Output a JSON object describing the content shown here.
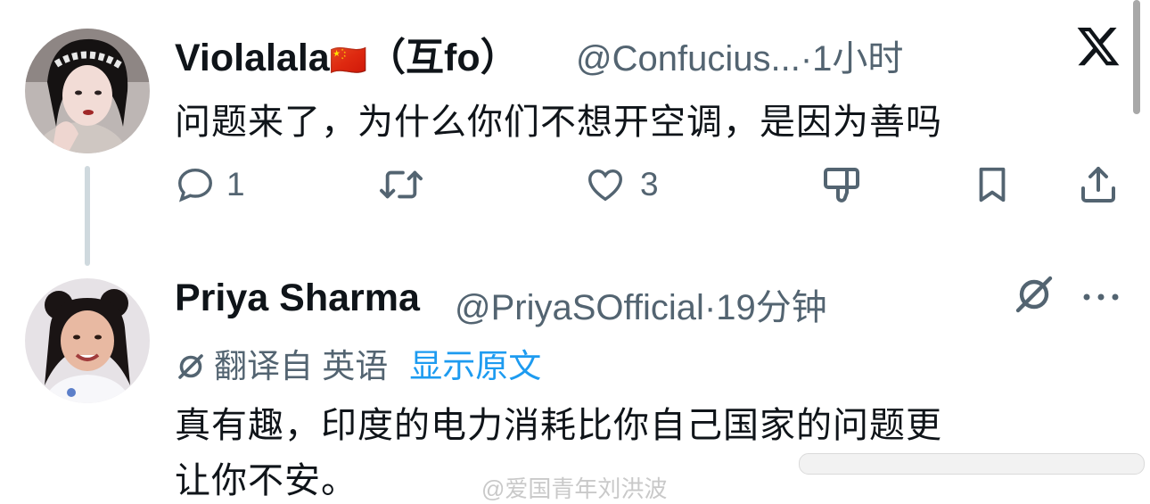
{
  "tweet1": {
    "display_name": "Violalala",
    "flag": "🇨🇳",
    "name_suffix": "（互fo）",
    "handle": "@Confucius...",
    "separator": "·",
    "time": "1小时",
    "text": "问题来了，为什么你们不想开空调，是因为善吗",
    "replies": "1",
    "likes": "3"
  },
  "tweet2": {
    "display_name": "Priya Sharma",
    "handle": "@PriyaSOfficial",
    "separator": "·",
    "time": "19分钟",
    "translated_label": "翻译自 英语",
    "show_original": "显示原文",
    "text_line1": "真有趣，印度的电力消耗比你自己国家的问题更",
    "text_line2": "让你不安。"
  },
  "watermark": "@爱国青年刘洪波",
  "colors": {
    "text": "#0f1419",
    "secondary": "#536471",
    "link": "#1d9bf0",
    "thread_line": "#cfd9de"
  },
  "icons": [
    "x-logo-icon",
    "reply-icon",
    "retweet-icon",
    "like-icon",
    "dislike-icon",
    "bookmark-icon",
    "share-icon",
    "grok-icon",
    "more-icon",
    "translate-icon"
  ]
}
